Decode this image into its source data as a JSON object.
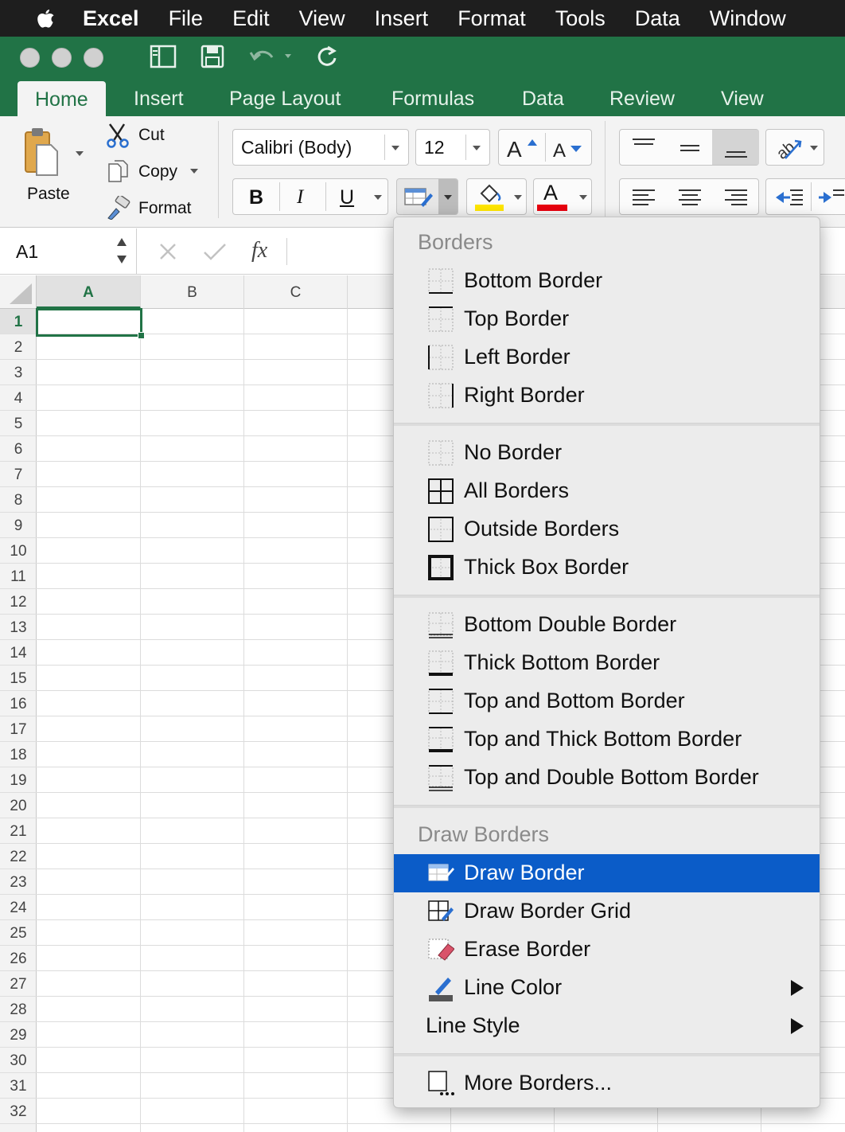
{
  "menubar": {
    "items": [
      "Excel",
      "File",
      "Edit",
      "View",
      "Insert",
      "Format",
      "Tools",
      "Data",
      "Window"
    ]
  },
  "ribbon": {
    "tabs": [
      "Home",
      "Insert",
      "Page Layout",
      "Formulas",
      "Data",
      "Review",
      "View"
    ],
    "active_tab": "Home",
    "paste_label": "Paste",
    "cut_label": "Cut",
    "copy_label": "Copy",
    "format_label": "Format",
    "font_name": "Calibri (Body)",
    "font_size": "12",
    "bold": "B",
    "italic": "I",
    "underline": "U",
    "font_color_letter": "A",
    "highlight_color": "#ffe600",
    "font_color": "#e8000f"
  },
  "formula_bar": {
    "name_box": "A1",
    "fx": "fx",
    "value": ""
  },
  "grid": {
    "columns": [
      "A",
      "B",
      "C"
    ],
    "rows": [
      "1",
      "2",
      "3",
      "4",
      "5",
      "6",
      "7",
      "8",
      "9",
      "10",
      "11",
      "12",
      "13",
      "14",
      "15",
      "16",
      "17",
      "18",
      "19",
      "20",
      "21",
      "22",
      "23",
      "24",
      "25",
      "26",
      "27",
      "28",
      "29",
      "30",
      "31",
      "32"
    ],
    "selected_cell": "A1"
  },
  "menu": {
    "section_borders": "Borders",
    "section_draw": "Draw Borders",
    "group1": [
      "Bottom Border",
      "Top Border",
      "Left Border",
      "Right Border"
    ],
    "group2": [
      "No Border",
      "All Borders",
      "Outside Borders",
      "Thick Box Border"
    ],
    "group3": [
      "Bottom Double Border",
      "Thick Bottom Border",
      "Top and Bottom Border",
      "Top and Thick Bottom Border",
      "Top and Double Bottom Border"
    ],
    "group4": [
      "Draw Border",
      "Draw Border Grid",
      "Erase Border",
      "Line Color",
      "Line Style"
    ],
    "more": "More Borders...",
    "highlighted": "Draw Border",
    "highlight_color": "#0b5cc8"
  },
  "icons": [
    "apple-icon",
    "sidebar-icon",
    "save-icon",
    "undo-icon",
    "redo-icon",
    "paste-icon",
    "scissors-icon",
    "copy-icon",
    "format-painter-icon",
    "borders-icon",
    "fill-color-icon",
    "font-color-icon",
    "align-top-icon",
    "align-middle-icon",
    "align-bottom-icon",
    "orientation-icon",
    "align-left-icon",
    "align-center-icon",
    "align-right-icon",
    "decrease-indent-icon",
    "increase-indent-icon",
    "cancel-icon",
    "enter-icon",
    "submenu-arrow-icon"
  ]
}
